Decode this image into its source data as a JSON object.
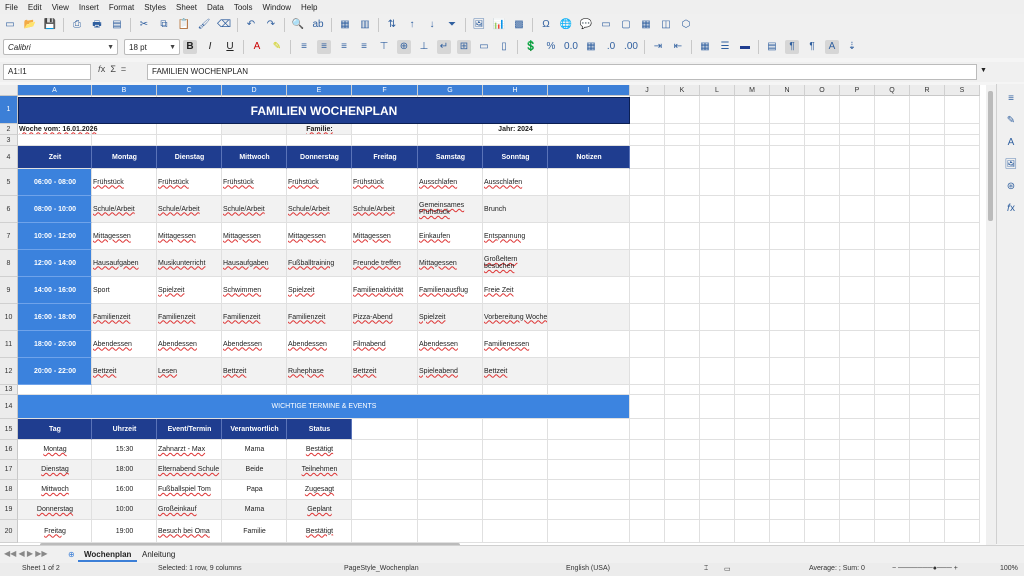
{
  "menu": [
    "File",
    "Edit",
    "View",
    "Insert",
    "Format",
    "Styles",
    "Sheet",
    "Data",
    "Tools",
    "Window",
    "Help"
  ],
  "toolbar": {
    "font_name": "Calibri",
    "font_size": "18 pt"
  },
  "formula_bar": {
    "name_box": "A1:I1",
    "content": "FAMILIEN WOCHENPLAN"
  },
  "columns": [
    "A",
    "B",
    "C",
    "D",
    "E",
    "F",
    "G",
    "H",
    "I",
    "J",
    "K",
    "L",
    "M",
    "N",
    "O",
    "P",
    "Q",
    "R",
    "S"
  ],
  "rows": [
    "1",
    "2",
    "3",
    "4",
    "5",
    "6",
    "7",
    "8",
    "9",
    "10",
    "11",
    "12",
    "13",
    "14",
    "15",
    "16",
    "17",
    "18",
    "19",
    "20"
  ],
  "sheet": {
    "title": "FAMILIEN WOCHENPLAN",
    "woche": "Woche vom: 16.01.2026",
    "familie": "Familie:",
    "jahr": "Jahr: 2024",
    "headers": [
      "Zeit",
      "Montag",
      "Dienstag",
      "Mittwoch",
      "Donnerstag",
      "Freitag",
      "Samstag",
      "Sonntag",
      "Notizen"
    ],
    "schedule": [
      [
        "06:00 - 08:00",
        "Frühstück",
        "Frühstück",
        "Frühstück",
        "Frühstück",
        "Frühstück",
        "Ausschlafen",
        "Ausschlafen",
        ""
      ],
      [
        "08:00 - 10:00",
        "Schule/Arbeit",
        "Schule/Arbeit",
        "Schule/Arbeit",
        "Schule/Arbeit",
        "Schule/Arbeit",
        "Gemeinsames Frühstück",
        "Brunch",
        ""
      ],
      [
        "10:00 - 12:00",
        "Mittagessen",
        "Mittagessen",
        "Mittagessen",
        "Mittagessen",
        "Mittagessen",
        "Einkaufen",
        "Entspannung",
        ""
      ],
      [
        "12:00 - 14:00",
        "Hausaufgaben",
        "Musikunterricht",
        "Hausaufgaben",
        "Fußballtraining",
        "Freunde treffen",
        "Mittagessen",
        "Großeltern besuchen",
        ""
      ],
      [
        "14:00 - 16:00",
        "Sport",
        "Spielzeit",
        "Schwimmen",
        "Spielzeit",
        "Familienaktivität",
        "Familienausflug",
        "Freie Zeit",
        ""
      ],
      [
        "16:00 - 18:00",
        "Familienzeit",
        "Familienzeit",
        "Familienzeit",
        "Familienzeit",
        "Pizza-Abend",
        "Spielzeit",
        "Vorbereitung Woche",
        ""
      ],
      [
        "18:00 - 20:00",
        "Abendessen",
        "Abendessen",
        "Abendessen",
        "Abendessen",
        "Filmabend",
        "Abendessen",
        "Familienessen",
        ""
      ],
      [
        "20:00 - 22:00",
        "Bettzeit",
        "Lesen",
        "Bettzeit",
        "Ruhephase",
        "Bettzeit",
        "Spieleabend",
        "Bettzeit",
        ""
      ]
    ],
    "events_title": "WICHTIGE TERMINE & EVENTS",
    "events_headers": [
      "Tag",
      "Uhrzeit",
      "Event/Termin",
      "Verantwortlich",
      "Status"
    ],
    "events": [
      [
        "Montag",
        "15:30",
        "Zahnarzt - Max",
        "Mama",
        "Bestätigt"
      ],
      [
        "Dienstag",
        "18:00",
        "Elternabend Schule",
        "Beide",
        "Teilnehmen"
      ],
      [
        "Mittwoch",
        "16:00",
        "Fußballspiel Tom",
        "Papa",
        "Zugesagt"
      ],
      [
        "Donnerstag",
        "10:00",
        "Großeinkauf",
        "Mama",
        "Geplant"
      ],
      [
        "Freitag",
        "19:00",
        "Besuch bei Oma",
        "Familie",
        "Bestätigt"
      ]
    ]
  },
  "tabs": [
    "Wochenplan",
    "Anleitung"
  ],
  "status": {
    "sheet": "Sheet 1 of 2",
    "selection": "Selected: 1 row, 9 columns",
    "page_style": "PageStyle_Wochenplan",
    "language": "English (USA)",
    "sum": "Average: ; Sum: 0",
    "zoom": "100%"
  },
  "colors": {
    "navy": "#1f3d8f",
    "blue": "#3c84e0",
    "selection": "#3c7fd7"
  }
}
